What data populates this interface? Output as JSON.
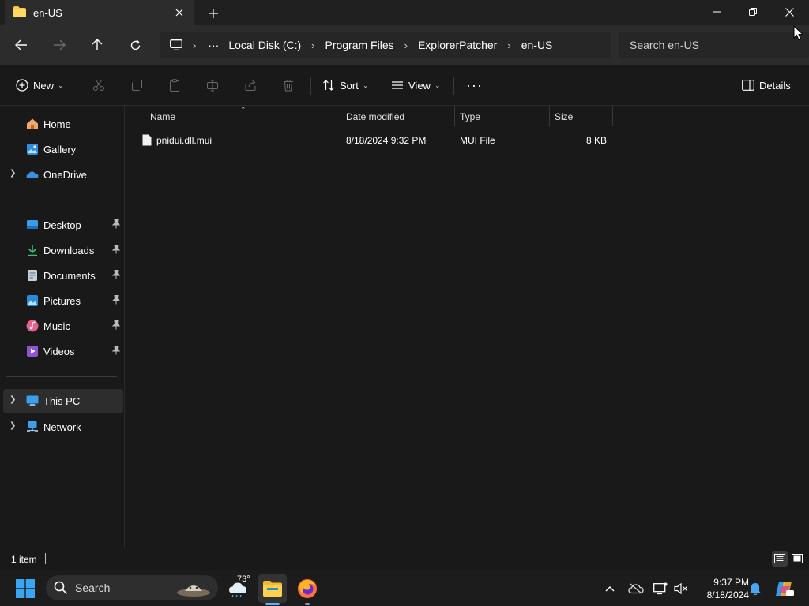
{
  "tab": {
    "title": "en-US"
  },
  "address": {
    "segments": [
      "Local Disk (C:)",
      "Program Files",
      "ExplorerPatcher",
      "en-US"
    ],
    "overflow": "···"
  },
  "search": {
    "placeholder": "Search en-US"
  },
  "commands": {
    "new": "New",
    "sort": "Sort",
    "view": "View",
    "more": "···",
    "details": "Details"
  },
  "sidebar": {
    "home": "Home",
    "gallery": "Gallery",
    "onedrive": "OneDrive",
    "desktop": "Desktop",
    "downloads": "Downloads",
    "documents": "Documents",
    "pictures": "Pictures",
    "music": "Music",
    "videos": "Videos",
    "thispc": "This PC",
    "network": "Network"
  },
  "columns": {
    "name": "Name",
    "date": "Date modified",
    "type": "Type",
    "size": "Size"
  },
  "files": [
    {
      "name": "pnidui.dll.mui",
      "date": "8/18/2024 9:32 PM",
      "type": "MUI File",
      "size": "8 KB"
    }
  ],
  "status": {
    "count": "1 item"
  },
  "taskbar": {
    "search": "Search",
    "temperature": "73°",
    "time": "9:37 PM",
    "date": "8/18/2024"
  },
  "colors": {
    "accent": "#5fb2f2",
    "folder": "#f7c843",
    "background": "#191919"
  }
}
